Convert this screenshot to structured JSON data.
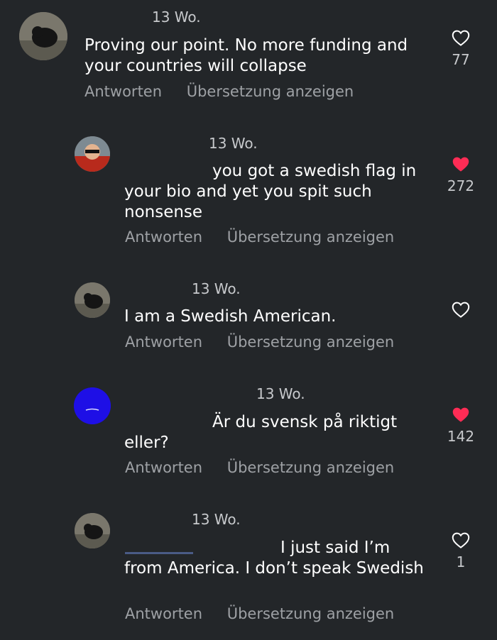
{
  "comments": [
    {
      "time": "13 Wo.",
      "text": "Proving our point. No more funding and your countries will collapse",
      "like_count": "77",
      "liked": false,
      "reply_label": "Antworten",
      "translate_label": "Übersetzung anzeigen"
    },
    {
      "time": "13 Wo.",
      "text": "you got a swedish flag in your bio and yet you spit such nonsense",
      "like_count": "272",
      "liked": true,
      "reply_label": "Antworten",
      "translate_label": "Übersetzung anzeigen"
    },
    {
      "time": "13 Wo.",
      "text": "I am a Swedish American.",
      "like_count": "",
      "liked": false,
      "reply_label": "Antworten",
      "translate_label": "Übersetzung anzeigen"
    },
    {
      "time": "13 Wo.",
      "text": "Är du svensk på riktigt eller?",
      "like_count": "142",
      "liked": true,
      "reply_label": "Antworten",
      "translate_label": "Übersetzung anzeigen"
    },
    {
      "time": "13 Wo.",
      "text": "I just said I’m from America. I don’t speak Swedish",
      "like_count": "1",
      "liked": false,
      "reply_label": "Antworten",
      "translate_label": "Übersetzung anzeigen"
    }
  ],
  "colors": {
    "background": "#232629",
    "liked_heart": "#fe2c55",
    "meta_text": "#9ea1a5"
  }
}
